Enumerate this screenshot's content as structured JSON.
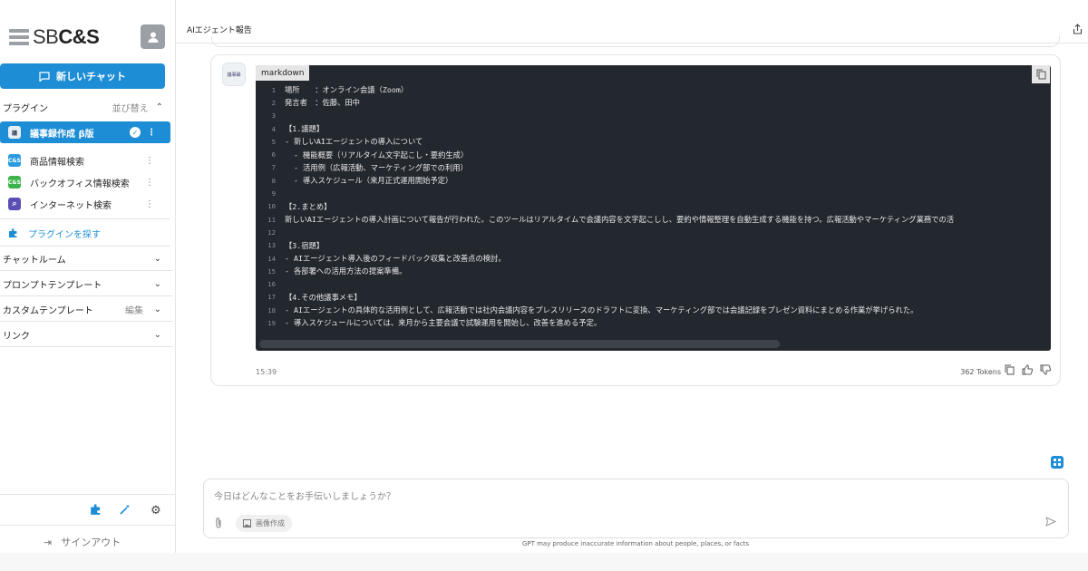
{
  "brand": {
    "logo_sb": "SB",
    "logo_cs": "C&S"
  },
  "sidebar": {
    "new_chat_label": "新しいチャット",
    "plugins_header": "プラグイン",
    "reorder_label": "並び替え",
    "plugins": [
      {
        "label": "議事録作成 β版",
        "icon": "minutes-icon",
        "active": true
      },
      {
        "label": "商品情報検索",
        "icon": "cs-icon",
        "active": false
      },
      {
        "label": "バックオフィス情報検索",
        "icon": "cs-green-icon",
        "active": false
      },
      {
        "label": "インターネット検索",
        "icon": "search-icon",
        "active": false
      }
    ],
    "find_plugin_label": "プラグインを探す",
    "menus": [
      {
        "label": "チャットルーム"
      },
      {
        "label": "プロンプトテンプレート"
      },
      {
        "label": "カスタムテンプレート",
        "edit": "編集"
      },
      {
        "label": "リンク"
      }
    ],
    "signout_label": "サインアウト"
  },
  "header": {
    "title": "AIエジェント報告"
  },
  "message": {
    "code_language": "markdown",
    "code_lines": [
      {
        "n": "1",
        "text": "場所　　：オンライン会議（Zoom）"
      },
      {
        "n": "2",
        "text": "発言者　：佐藤、田中"
      },
      {
        "n": "3",
        "text": ""
      },
      {
        "n": "4",
        "text": "【1.議題】"
      },
      {
        "n": "5",
        "text": "- 新しいAIエージェントの導入について"
      },
      {
        "n": "6",
        "text": "  - 機能概要（リアルタイム文字起こし・要約生成）"
      },
      {
        "n": "7",
        "text": "  - 活用例（広報活動、マーケティング部での利用）"
      },
      {
        "n": "8",
        "text": "  - 導入スケジュール（来月正式運用開始予定）"
      },
      {
        "n": "9",
        "text": ""
      },
      {
        "n": "10",
        "text": "【2.まとめ】"
      },
      {
        "n": "11",
        "text": "新しいAIエージェントの導入計画について報告が行われた。このツールはリアルタイムで会議内容を文字起こしし、要約や情報整理を自動生成する機能を持つ。広報活動やマーケティング業務での活"
      },
      {
        "n": "12",
        "text": ""
      },
      {
        "n": "13",
        "text": "【3.宿題】"
      },
      {
        "n": "14",
        "text": "- AIエージェント導入後のフィードバック収集と改善点の検討。"
      },
      {
        "n": "15",
        "text": "- 各部署への活用方法の提案準備。"
      },
      {
        "n": "16",
        "text": ""
      },
      {
        "n": "17",
        "text": "【4.その他議事メモ】"
      },
      {
        "n": "18",
        "text": "- AIエージェントの具体的な活用例として、広報活動では社内会議内容をプレスリリースのドラフトに変換、マーケティング部では会議記録をプレゼン資料にまとめる作業が挙げられた。"
      },
      {
        "n": "19",
        "text": "- 導入スケジュールについては、来月から主要会議で試験運用を開始し、改善を進める予定。"
      }
    ],
    "time": "15:39",
    "tokens": "362 Tokens"
  },
  "composer": {
    "placeholder": "今日はどんなことをお手伝いしましょうか？",
    "image_button_label": "画像作成"
  },
  "disclaimer": "GPT may produce inaccurate information about people, places, or facts",
  "colors": {
    "accent": "#1d8ed6",
    "code_bg": "#23272e"
  }
}
